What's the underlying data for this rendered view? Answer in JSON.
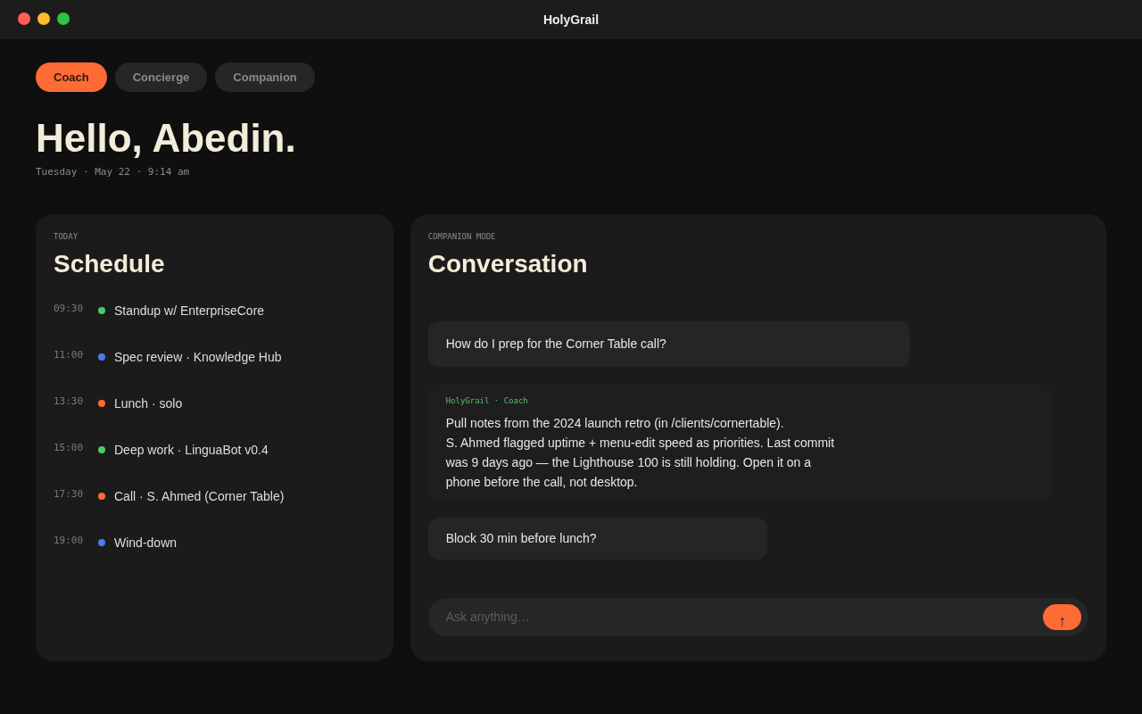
{
  "window": {
    "title": "HolyGrail"
  },
  "tabs": [
    {
      "label": "Coach",
      "selected": true
    },
    {
      "label": "Concierge",
      "selected": false
    },
    {
      "label": "Companion",
      "selected": false
    }
  ],
  "greeting": {
    "title": "Hello, Abedin.",
    "date": "Tuesday · May 22 · 9:14 am"
  },
  "schedule": {
    "eyebrow": "TODAY",
    "title": "Schedule",
    "items": [
      {
        "time": "09:30",
        "label": "Standup w/ EnterpriseCore",
        "color": "#4cc96a"
      },
      {
        "time": "11:00",
        "label": "Spec review · Knowledge Hub",
        "color": "#4a7cf0"
      },
      {
        "time": "13:30",
        "label": "Lunch · solo",
        "color": "#ff6b35"
      },
      {
        "time": "15:00",
        "label": "Deep work · LinguaBot v0.4",
        "color": "#4cc96a"
      },
      {
        "time": "17:30",
        "label": "Call · S. Ahmed (Corner Table)",
        "color": "#ff6b35"
      },
      {
        "time": "19:00",
        "label": "Wind-down",
        "color": "#4a7cf0"
      }
    ]
  },
  "conversation": {
    "eyebrow": "COMPANION MODE",
    "title": "Conversation",
    "messages": [
      {
        "kind": "user",
        "text": "How do I prep for the Corner Table call?"
      },
      {
        "kind": "assistant",
        "author": "HolyGrail · Coach",
        "text": "Pull notes from the 2024 launch retro (in /clients/cornertable).\nS. Ahmed flagged uptime + menu-edit speed as priorities. Last commit was 9 days ago — the Lighthouse 100 is still holding. Open it on a phone before the call, not desktop."
      },
      {
        "kind": "user",
        "text": "Block 30 min before lunch?"
      }
    ],
    "composer": {
      "placeholder": "Ask anything…",
      "send_label": "↑"
    }
  }
}
